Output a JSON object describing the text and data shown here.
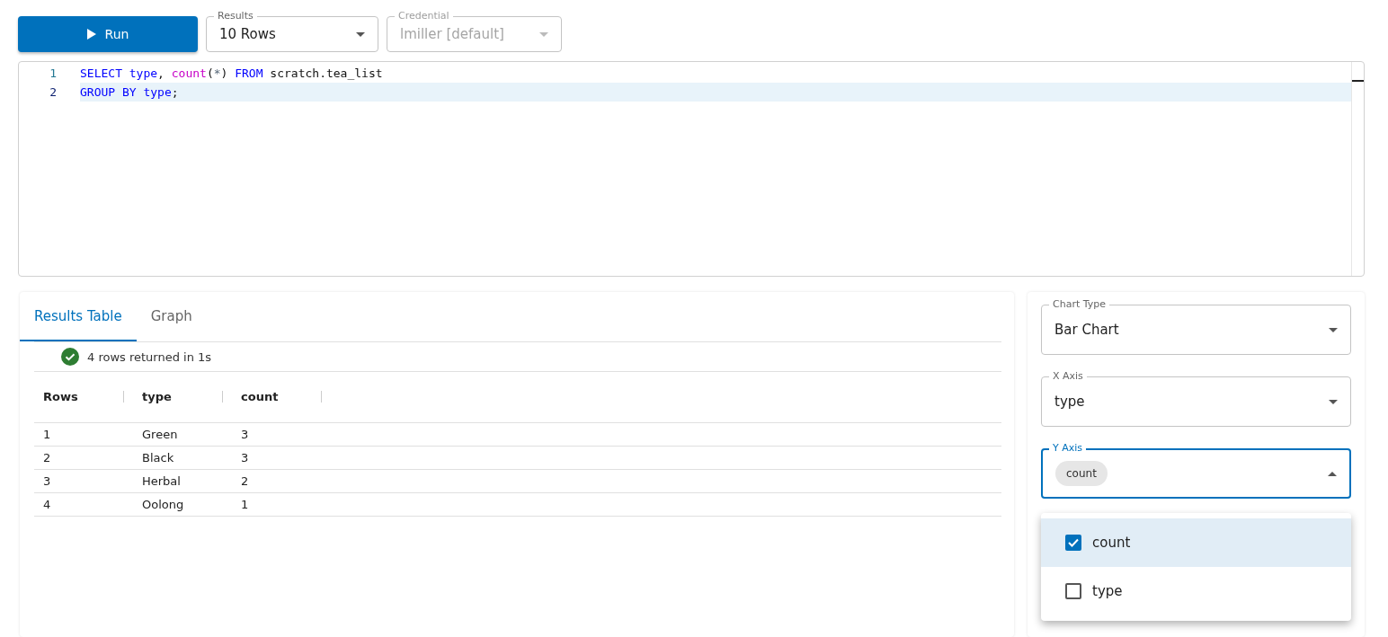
{
  "toolbar": {
    "run_button": "Run",
    "results_select": {
      "label": "Results",
      "value": "10 Rows",
      "disabled": false
    },
    "credential_select": {
      "label": "Credential",
      "value": "lmiller [default]",
      "disabled": true
    }
  },
  "editor": {
    "lines": [
      {
        "number": "1",
        "active": false,
        "tokens": [
          {
            "kind": "keyword",
            "text": "SELECT"
          },
          {
            "kind": "keyword",
            "text": " type"
          },
          {
            "kind": "plain",
            "text": ", "
          },
          {
            "kind": "function",
            "text": "count"
          },
          {
            "kind": "plain",
            "text": "("
          },
          {
            "kind": "operator",
            "text": "*"
          },
          {
            "kind": "plain",
            "text": ") "
          },
          {
            "kind": "keyword",
            "text": "FROM"
          },
          {
            "kind": "plain",
            "text": " scratch.tea_list"
          }
        ]
      },
      {
        "number": "2",
        "active": true,
        "tokens": [
          {
            "kind": "keyword",
            "text": "GROUP BY"
          },
          {
            "kind": "keyword",
            "text": " type"
          },
          {
            "kind": "plain",
            "text": ";"
          }
        ]
      }
    ]
  },
  "tabs": [
    {
      "label": "Results Table",
      "selected": true
    },
    {
      "label": "Graph",
      "selected": false
    }
  ],
  "status": {
    "kind": "success",
    "text": "4 rows returned in 1s"
  },
  "table": {
    "columns": [
      "Rows",
      "type",
      "count"
    ],
    "rows": [
      [
        "1",
        "Green",
        "3"
      ],
      [
        "2",
        "Black",
        "3"
      ],
      [
        "3",
        "Herbal",
        "2"
      ],
      [
        "4",
        "Oolong",
        "1"
      ]
    ]
  },
  "chart_settings": {
    "chart_type": {
      "label": "Chart Type",
      "value": "Bar Chart",
      "focused": false
    },
    "x_axis": {
      "label": "X Axis",
      "value": "type",
      "focused": false
    },
    "y_axis": {
      "label": "Y Axis",
      "chips": [
        "count"
      ],
      "focused": true,
      "expanded": true,
      "options": [
        {
          "label": "count",
          "checked": true,
          "selected": true
        },
        {
          "label": "type",
          "checked": false,
          "selected": false
        }
      ]
    }
  }
}
